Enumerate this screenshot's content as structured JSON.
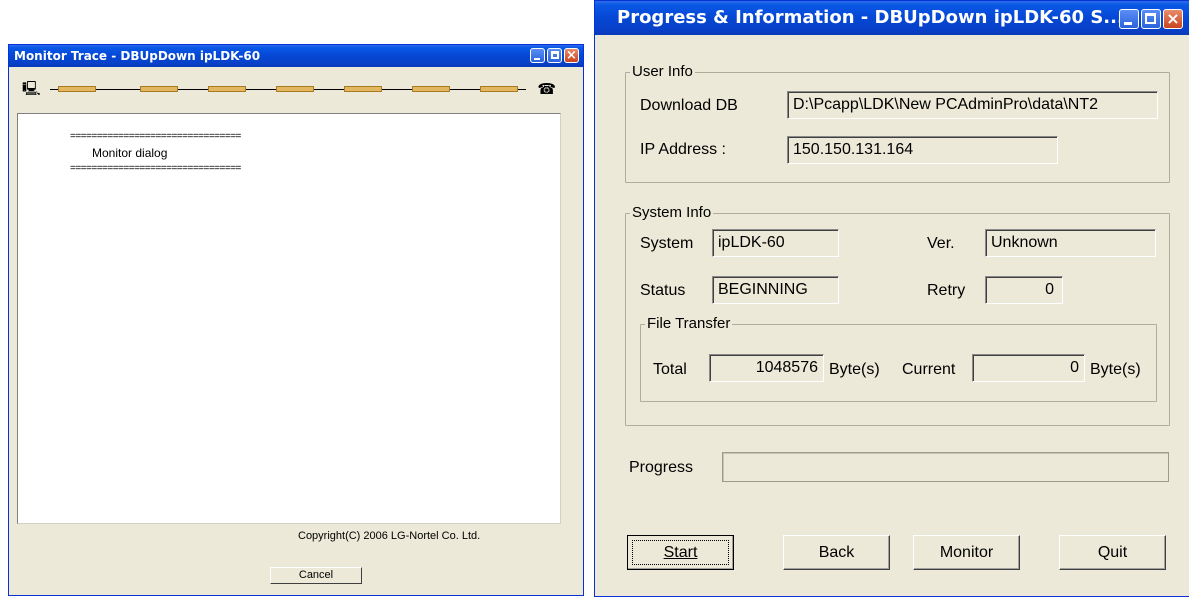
{
  "monitor_window": {
    "title": "Monitor Trace - DBUpDown ipLDK-60",
    "connection": {
      "left_icon": "pc-icon",
      "right_icon": "phone-icon"
    },
    "trace_lines": {
      "separator": "================================",
      "message": "Monitor dialog"
    },
    "copyright": "Copyright(C) 2006 LG-Nortel Co. Ltd.",
    "cancel_label": "Cancel"
  },
  "progress_window": {
    "title": "Progress & Information - DBUpDown ipLDK-60 S...",
    "user_info": {
      "legend": "User Info",
      "download_db_label": "Download DB",
      "download_db_value": "D:\\Pcapp\\LDK\\New PCAdminPro\\data\\NT2",
      "ip_label": "IP Address :",
      "ip_value": "150.150.131.164"
    },
    "system_info": {
      "legend": "System Info",
      "system_label": "System",
      "system_value": "ipLDK-60",
      "ver_label": "Ver.",
      "ver_value": "Unknown",
      "status_label": "Status",
      "status_value": "BEGINNING",
      "retry_label": "Retry",
      "retry_value": "0",
      "file_transfer": {
        "legend": "File Transfer",
        "total_label": "Total",
        "total_value": "1048576",
        "total_unit": "Byte(s)",
        "current_label": "Current",
        "current_value": "0",
        "current_unit": "Byte(s)"
      }
    },
    "progress": {
      "label": "Progress",
      "fraction": 0
    },
    "buttons": {
      "start": "Start",
      "back": "Back",
      "monitor": "Monitor",
      "quit": "Quit"
    }
  },
  "colors": {
    "titlebar": "#0547d4",
    "window_bg": "#ece9d8",
    "close_button": "#c9441e"
  }
}
